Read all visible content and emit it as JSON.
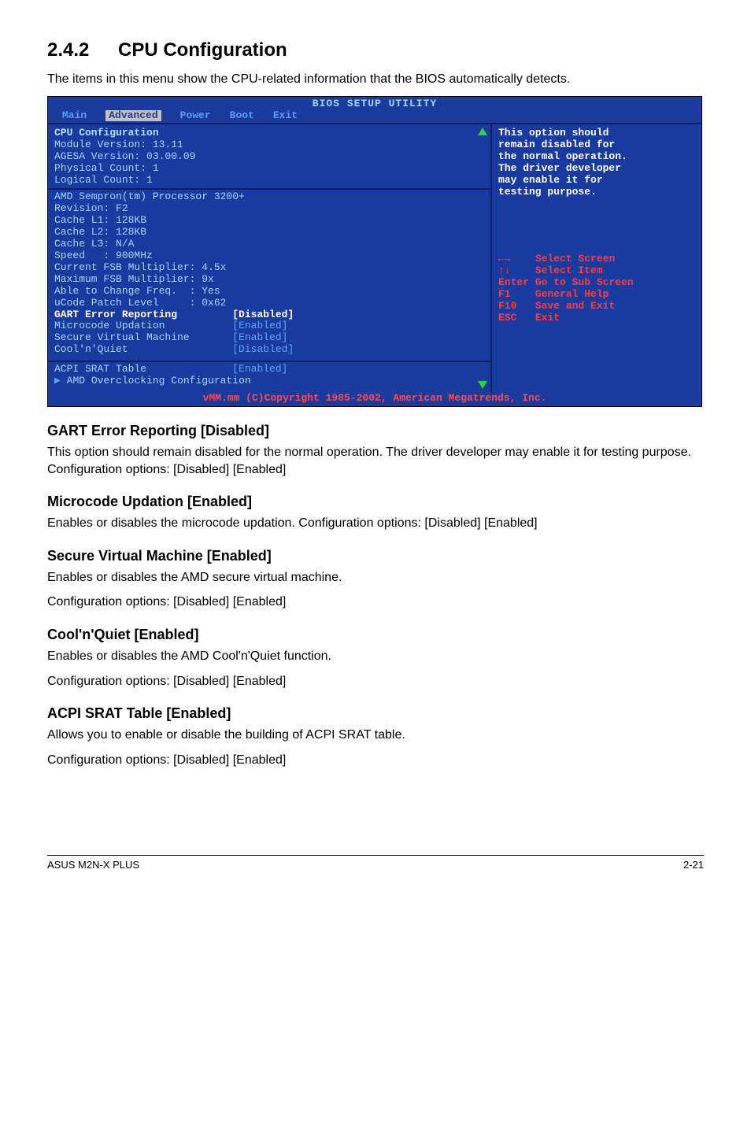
{
  "heading": {
    "number": "2.4.2",
    "title": "CPU Configuration"
  },
  "intro": "The items in this menu show the CPU-related information that the BIOS automatically detects.",
  "bios": {
    "title": "BIOS SETUP UTILITY",
    "tabs": {
      "main": "Main",
      "advanced": "Advanced",
      "power": "Power",
      "boot": "Boot",
      "exit": "Exit"
    },
    "left": {
      "header": "CPU Configuration",
      "module": "Module Version: 13.11",
      "agesa": "AGESA Version: 03.00.09",
      "physical": "Physical Count: 1",
      "logical": "Logical Count: 1",
      "proc": "AMD Sempron(tm) Processor 3200+",
      "revision": "Revision: F2",
      "l1": "Cache L1: 128KB",
      "l2": "Cache L2: 128KB",
      "l3": "Cache L3: N/A",
      "speed": "Speed   : 900MHz",
      "cur_mult": "Current FSB Multiplier: 4.5x",
      "max_mult": "Maximum FSB Multiplier: 9x",
      "able": "Able to Change Freq.  : Yes",
      "ucode": "uCode Patch Level     : 0x62",
      "gart_label": "GART Error Reporting",
      "gart_val": "[Disabled]",
      "micro_label": "Microcode Updation",
      "micro_val": "[Enabled]",
      "svm_label": "Secure Virtual Machine",
      "svm_val": "[Enabled]",
      "cool_label": "Cool'n'Quiet",
      "cool_val": "[Disabled]",
      "srat_label": "ACPI SRAT Table",
      "srat_val": "[Enabled]",
      "amd_oc": "AMD Overclocking Configuration"
    },
    "right": {
      "help1": "This option should",
      "help2": "remain disabled for",
      "help3": "the normal operation.",
      "help4": "The driver developer",
      "help5": "may enable it for",
      "help6": "testing purpose.",
      "k_lr": "←→",
      "k_lr_txt": "Select Screen",
      "k_ud": "↑↓",
      "k_ud_txt": "Select Item",
      "k_enter": "Enter",
      "k_enter_txt": "Go to Sub Screen",
      "k_f1": "F1",
      "k_f1_txt": "General Help",
      "k_f10": "F10",
      "k_f10_txt": "Save and Exit",
      "k_esc": "ESC",
      "k_esc_txt": "Exit"
    },
    "copyright": "vMM.mm (C)Copyright 1985-2002, American Megatrends, Inc."
  },
  "sections": {
    "gart": {
      "title": "GART Error Reporting [Disabled]",
      "text": "This option should remain disabled for the normal operation. The driver developer may enable it for testing purpose. Configuration options: [Disabled] [Enabled]"
    },
    "micro": {
      "title": "Microcode Updation [Enabled]",
      "text": "Enables or disables the microcode updation. Configuration options: [Disabled] [Enabled]"
    },
    "svm": {
      "title": "Secure Virtual Machine [Enabled]",
      "text1": "Enables or disables the AMD secure virtual machine.",
      "text2": "Configuration options: [Disabled] [Enabled]"
    },
    "cool": {
      "title": "Cool'n'Quiet [Enabled]",
      "text1": "Enables or disables the AMD Cool'n'Quiet function.",
      "text2": "Configuration options: [Disabled] [Enabled]"
    },
    "srat": {
      "title": "ACPI SRAT Table [Enabled]",
      "text1": "Allows you to enable or disable the building of ACPI SRAT table.",
      "text2": "Configuration options: [Disabled] [Enabled]"
    }
  },
  "footer": {
    "left": "ASUS M2N-X PLUS",
    "right": "2-21"
  }
}
